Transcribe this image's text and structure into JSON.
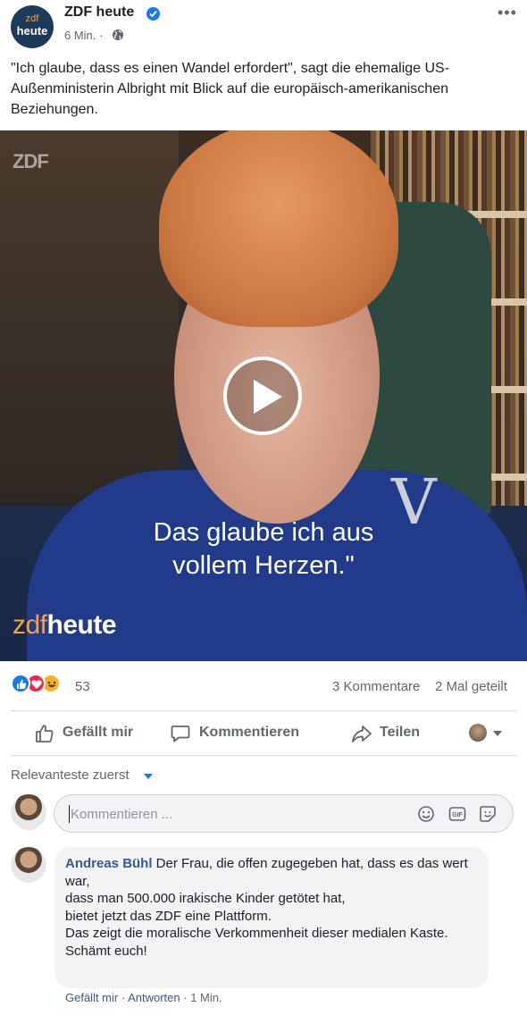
{
  "post": {
    "page_name": "ZDF heute",
    "avatar_line1": "zdf",
    "avatar_line2": "heute",
    "time": "6 Min. ·",
    "more": "•••",
    "text": "\"Ich glaube, dass es einen Wandel erfordert\", sagt die ehemalige US-Außenministerin Albright mit Blick auf die europäisch-amerikanischen Beziehungen."
  },
  "video": {
    "watermark": "ZDF",
    "subtitle_line1": "Das glaube ich aus",
    "subtitle_line2": "vollem Herzen.\"",
    "logo_zdf": "zdf",
    "logo_heute": "heute",
    "brooch": "V"
  },
  "stats": {
    "reaction_count": "53",
    "comments": "3 Kommentare",
    "shares": "2 Mal geteilt"
  },
  "actions": {
    "like": "Gefällt mir",
    "comment": "Kommentieren",
    "share": "Teilen"
  },
  "comments": {
    "sort_label": "Relevanteste zuerst",
    "composer_placeholder": "Kommentieren ...",
    "items": [
      {
        "author": "Andreas Bühl",
        "text": " Der Frau, die offen zugegeben hat, dass es das wert war,\ndass man 500.000 irakische Kinder getötet hat,\nbietet jetzt das ZDF eine Plattform.\nDas zeigt die moralische Verkommenheit dieser medialen Kaste.\nSchämt euch!",
        "like_link": "Gefällt mir",
        "reply_link": "Antworten",
        "time": "1 Min."
      }
    ]
  },
  "colors": {
    "accent": "#1877f2",
    "link": "#385898",
    "muted": "#606770",
    "zdf_orange": "#f7a23b"
  }
}
